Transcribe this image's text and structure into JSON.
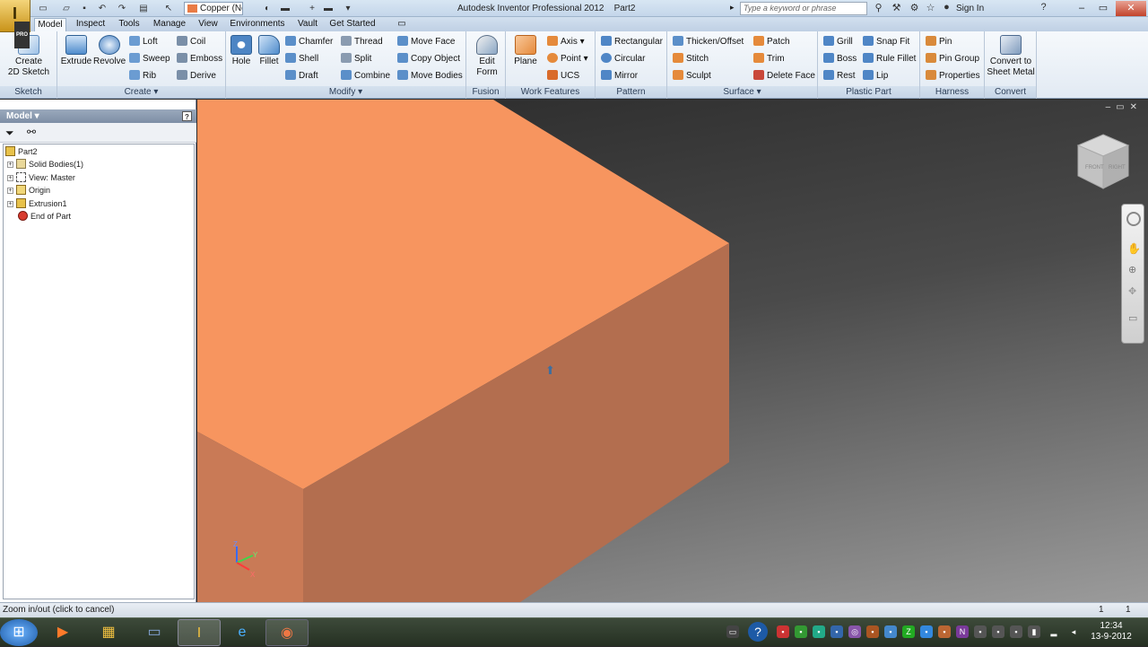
{
  "app": {
    "logo_letter": "I",
    "logo_badge": "PRO",
    "title": "Autodesk Inventor Professional 2012",
    "document": "Part2"
  },
  "quick_access": {
    "material": "Copper (Ne",
    "search_placeholder": "Type a keyword or phrase",
    "signin_label": "Sign In"
  },
  "tabs": [
    "Model",
    "Inspect",
    "Tools",
    "Manage",
    "View",
    "Environments",
    "Vault",
    "Get Started"
  ],
  "ribbon": {
    "sketch": {
      "label": "Sketch",
      "create_2d_sketch": "Create\n2D Sketch"
    },
    "create": {
      "label": "Create",
      "extrude": "Extrude",
      "revolve": "Revolve",
      "loft": "Loft",
      "sweep": "Sweep",
      "rib": "Rib",
      "coil": "Coil",
      "emboss": "Emboss",
      "derive": "Derive"
    },
    "modify": {
      "label": "Modify",
      "hole": "Hole",
      "fillet": "Fillet",
      "chamfer": "Chamfer",
      "shell": "Shell",
      "draft": "Draft",
      "thread": "Thread",
      "split": "Split",
      "combine": "Combine",
      "move_face": "Move Face",
      "copy_object": "Copy Object",
      "move_bodies": "Move Bodies"
    },
    "fusion": {
      "label": "Fusion",
      "edit_form": "Edit\nForm"
    },
    "work_features": {
      "label": "Work Features",
      "plane": "Plane",
      "axis": "Axis",
      "point": "Point",
      "ucs": "UCS"
    },
    "pattern": {
      "label": "Pattern",
      "rectangular": "Rectangular",
      "circular": "Circular",
      "mirror": "Mirror"
    },
    "surface": {
      "label": "Surface",
      "thicken_offset": "Thicken/Offset",
      "stitch": "Stitch",
      "sculpt": "Sculpt",
      "patch": "Patch",
      "trim": "Trim",
      "delete_face": "Delete Face"
    },
    "plastic_part": {
      "label": "Plastic Part",
      "grill": "Grill",
      "boss": "Boss",
      "rest": "Rest",
      "snap_fit": "Snap Fit",
      "rule_fillet": "Rule Fillet",
      "lip": "Lip"
    },
    "harness": {
      "label": "Harness",
      "pin": "Pin",
      "pin_group": "Pin Group",
      "properties": "Properties"
    },
    "convert": {
      "label": "Convert",
      "convert_to_sheet_metal": "Convert to\nSheet Metal"
    }
  },
  "browser": {
    "title": "Model",
    "help": "?",
    "tree": [
      {
        "label": "Part2"
      },
      {
        "label": "Solid Bodies(1)"
      },
      {
        "label": "View: Master"
      },
      {
        "label": "Origin"
      },
      {
        "label": "Extrusion1"
      },
      {
        "label": "End of Part"
      }
    ]
  },
  "viewcube": {
    "face_front": "FRONT",
    "face_right": "RIGHT"
  },
  "triad": {
    "z": "Z",
    "y": "Y",
    "x": "X"
  },
  "status": {
    "message": "Zoom in/out (click to cancel)",
    "field1": "1",
    "field2": "1"
  },
  "clock": {
    "time": "12:34",
    "date": "13-9-2012"
  },
  "colors": {
    "part_top": "#f7955f",
    "part_front": "#b36e4f",
    "part_side": "#c97a56",
    "accent": "#e97b45"
  }
}
